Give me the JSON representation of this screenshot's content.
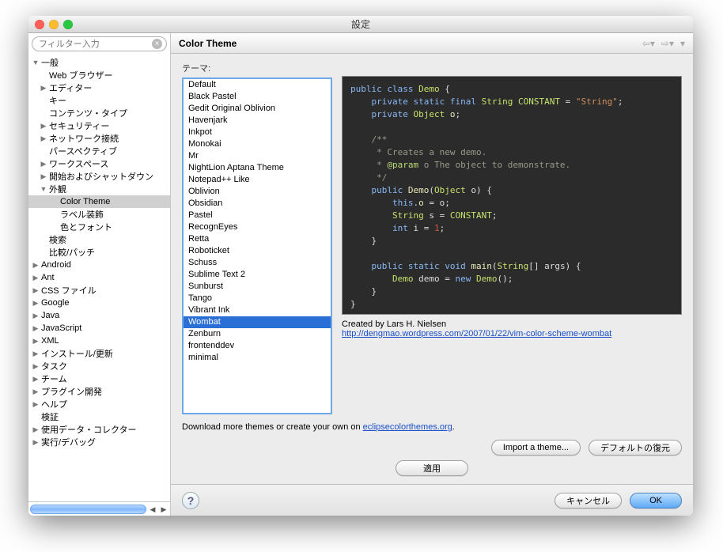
{
  "window": {
    "title": "設定"
  },
  "filter": {
    "placeholder": "フィルター入力"
  },
  "tree": [
    {
      "label": "一般",
      "depth": 0,
      "disc": "▼"
    },
    {
      "label": "Web ブラウザー",
      "depth": 1,
      "disc": ""
    },
    {
      "label": "エディター",
      "depth": 1,
      "disc": "▶"
    },
    {
      "label": "キー",
      "depth": 1,
      "disc": ""
    },
    {
      "label": "コンテンツ・タイプ",
      "depth": 1,
      "disc": ""
    },
    {
      "label": "セキュリティー",
      "depth": 1,
      "disc": "▶"
    },
    {
      "label": "ネットワーク接続",
      "depth": 1,
      "disc": "▶"
    },
    {
      "label": "パースペクティブ",
      "depth": 1,
      "disc": ""
    },
    {
      "label": "ワークスペース",
      "depth": 1,
      "disc": "▶"
    },
    {
      "label": "開始およびシャットダウン",
      "depth": 1,
      "disc": "▶"
    },
    {
      "label": "外観",
      "depth": 1,
      "disc": "▼"
    },
    {
      "label": "Color Theme",
      "depth": 2,
      "disc": "",
      "selected": true
    },
    {
      "label": "ラベル装飾",
      "depth": 2,
      "disc": ""
    },
    {
      "label": "色とフォント",
      "depth": 2,
      "disc": ""
    },
    {
      "label": "検索",
      "depth": 1,
      "disc": ""
    },
    {
      "label": "比較/パッチ",
      "depth": 1,
      "disc": ""
    },
    {
      "label": "Android",
      "depth": 0,
      "disc": "▶"
    },
    {
      "label": "Ant",
      "depth": 0,
      "disc": "▶"
    },
    {
      "label": "CSS ファイル",
      "depth": 0,
      "disc": "▶"
    },
    {
      "label": "Google",
      "depth": 0,
      "disc": "▶"
    },
    {
      "label": "Java",
      "depth": 0,
      "disc": "▶"
    },
    {
      "label": "JavaScript",
      "depth": 0,
      "disc": "▶"
    },
    {
      "label": "XML",
      "depth": 0,
      "disc": "▶"
    },
    {
      "label": "インストール/更新",
      "depth": 0,
      "disc": "▶"
    },
    {
      "label": "タスク",
      "depth": 0,
      "disc": "▶"
    },
    {
      "label": "チーム",
      "depth": 0,
      "disc": "▶"
    },
    {
      "label": "プラグイン開発",
      "depth": 0,
      "disc": "▶"
    },
    {
      "label": "ヘルプ",
      "depth": 0,
      "disc": "▶"
    },
    {
      "label": "検証",
      "depth": 0,
      "disc": ""
    },
    {
      "label": "使用データ・コレクター",
      "depth": 0,
      "disc": "▶"
    },
    {
      "label": "実行/デバッグ",
      "depth": 0,
      "disc": "▶"
    }
  ],
  "header": {
    "title": "Color Theme"
  },
  "theme_label": "テーマ:",
  "themes": [
    "Default",
    "Black Pastel",
    "Gedit Original Oblivion",
    "Havenjark",
    "Inkpot",
    "Monokai",
    "Mr",
    "NightLion Aptana Theme",
    "Notepad++ Like",
    "Oblivion",
    "Obsidian",
    "Pastel",
    "RecognEyes",
    "Retta",
    "Roboticket",
    "Schuss",
    "Sublime Text 2",
    "Sunburst",
    "Tango",
    "Vibrant Ink",
    "Wombat",
    "Zenburn",
    "frontenddev",
    "minimal"
  ],
  "selected_theme": "Wombat",
  "credit": {
    "text": "Created by Lars H. Nielsen",
    "url": "http://dengmao.wordpress.com/2007/01/22/vim-color-scheme-wombat"
  },
  "download": {
    "prefix": "Download more themes or create your own on ",
    "link_text": "eclipsecolorthemes.org",
    "suffix": "."
  },
  "buttons": {
    "import": "Import a theme...",
    "restore": "デフォルトの復元",
    "apply": "適用",
    "cancel": "キャンセル",
    "ok": "OK"
  },
  "code": {
    "l1a": "public",
    "l1b": "class",
    "l1c": "Demo",
    "l1d": "{",
    "l2a": "private",
    "l2b": "static",
    "l2c": "final",
    "l2d": "String",
    "l2e": "CONSTANT",
    "l2f": "=",
    "l2g": "\"String\"",
    "l2h": ";",
    "l3a": "private",
    "l3b": "Object",
    "l3c": "o",
    "l3d": ";",
    "l4": "/**",
    "l5": " * Creates a new demo.",
    "l6a": " * ",
    "l6b": "@param",
    "l6c": " o The object to demonstrate.",
    "l7": " */",
    "l8a": "public",
    "l8b": "Demo",
    "l8c": "(",
    "l8d": "Object",
    "l8e": "o",
    "l8f": ") {",
    "l9a": "this",
    "l9b": ".",
    "l9c": "o",
    "l9d": " = ",
    "l9e": "o",
    "l9f": ";",
    "l10a": "String",
    "l10b": "s",
    "l10c": " = ",
    "l10d": "CONSTANT",
    "l10e": ";",
    "l11a": "int",
    "l11b": "i",
    "l11c": " = ",
    "l11d": "1",
    "l11e": ";",
    "l12": "}",
    "l13a": "public",
    "l13b": "static",
    "l13c": "void",
    "l13d": "main",
    "l13e": "(",
    "l13f": "String",
    "l13g": "[] ",
    "l13h": "args",
    "l13i": ") {",
    "l14a": "Demo",
    "l14b": "demo",
    "l14c": " = ",
    "l14d": "new",
    "l14e": "Demo",
    "l14f": "();",
    "l15": "}",
    "l16": "}"
  }
}
